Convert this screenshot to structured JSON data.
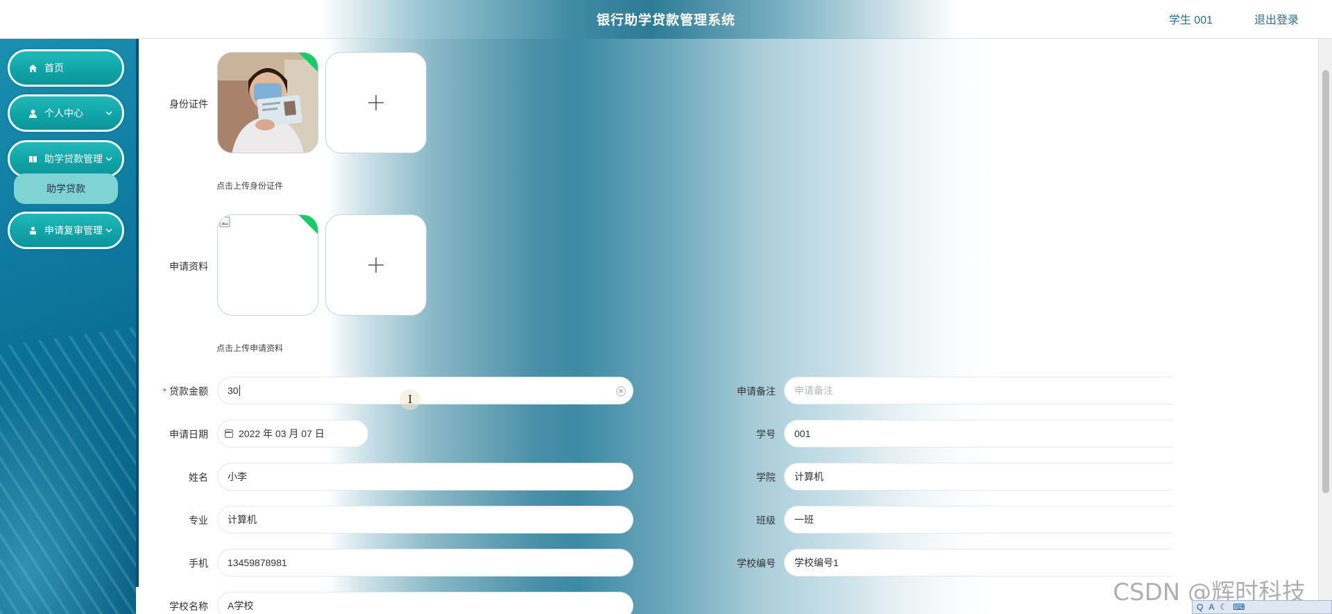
{
  "header": {
    "title": "银行助学贷款管理系统",
    "user": "学生 001",
    "logout": "退出登录"
  },
  "sidebar": {
    "items": [
      {
        "label": "首页",
        "icon": "home-icon"
      },
      {
        "label": "个人中心",
        "icon": "user-icon"
      },
      {
        "label": "助学贷款管理",
        "icon": "book-icon"
      },
      {
        "label": "申请复审管理",
        "icon": "person-icon"
      }
    ],
    "submenu": {
      "label": "助学贷款"
    }
  },
  "form": {
    "id_card": {
      "label": "身份证件",
      "tip": "点击上传身份证件"
    },
    "materials": {
      "label": "申请资料",
      "tip": "点击上传申请资料"
    },
    "loan_amount": {
      "label": "贷款金额",
      "value": "30"
    },
    "remark": {
      "label": "申请备注",
      "placeholder": "申请备注"
    },
    "apply_date": {
      "label": "申请日期",
      "value": "2022 年 03 月 07 日"
    },
    "student_no": {
      "label": "学号",
      "value": "001"
    },
    "name": {
      "label": "姓名",
      "value": "小李"
    },
    "college": {
      "label": "学院",
      "value": "计算机"
    },
    "major": {
      "label": "专业",
      "value": "计算机"
    },
    "class": {
      "label": "班级",
      "value": "一班"
    },
    "phone": {
      "label": "手机",
      "value": "13459878981"
    },
    "school_code": {
      "label": "学校编号",
      "value": "学校编号1"
    },
    "school_name": {
      "label": "学校名称",
      "value": "A学校"
    }
  },
  "watermark": "CSDN @辉时科技",
  "tray": [
    "Q",
    "A"
  ],
  "colors": {
    "accent": "#10a4a8",
    "header_text": "#2c6f8a",
    "success": "#13ce66"
  }
}
